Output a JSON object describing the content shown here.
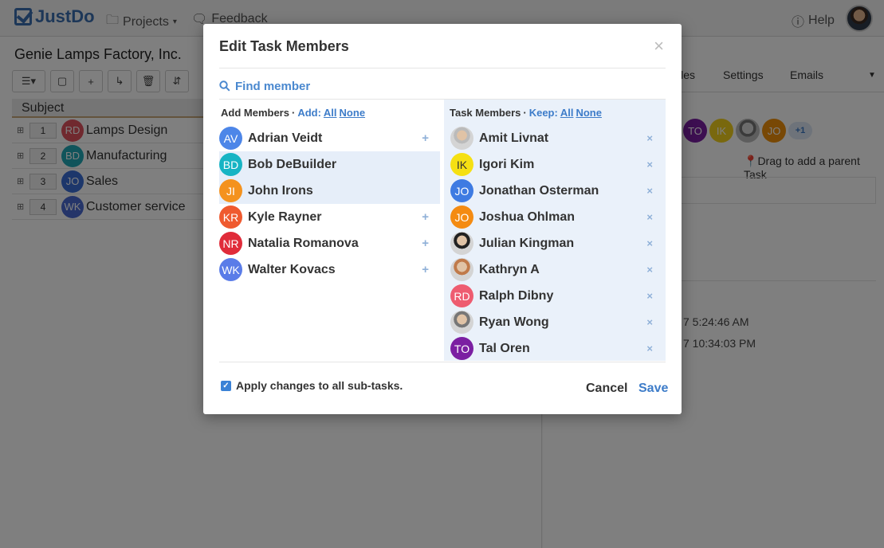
{
  "topbar": {
    "logo_text": "JustDo",
    "projects_label": "Projects",
    "feedback_label": "Feedback",
    "help_label": "Help"
  },
  "left": {
    "project_title": "Genie Lamps Factory, Inc.",
    "subject_header": "Subject",
    "rows": [
      {
        "num": "1",
        "initials": "RD",
        "color": "#e0525f",
        "title": "Lamps Design"
      },
      {
        "num": "2",
        "initials": "BD",
        "color": "#21a9b6",
        "title": "Manufacturing"
      },
      {
        "num": "3",
        "initials": "JO",
        "color": "#3a6fd6",
        "title": "Sales"
      },
      {
        "num": "4",
        "initials": "WK",
        "color": "#4b6bd3",
        "title": "Customer service"
      }
    ]
  },
  "right": {
    "tabs": [
      "iles",
      "Settings",
      "Emails"
    ],
    "members": [
      {
        "initials": "TO",
        "color": "#7b1fa2"
      },
      {
        "initials": "IK",
        "color": "#f3d11c"
      },
      {
        "initials": "",
        "color": "#8a8a8a"
      },
      {
        "initials": "JO",
        "color": "#f0900a"
      }
    ],
    "more_badge": "+1",
    "drag_text": "Drag to add a parent Task",
    "timestamps": [
      "7 5:24:46 AM",
      "7 10:34:03 PM"
    ]
  },
  "modal": {
    "title": "Edit Task Members",
    "close_label": "×",
    "search_placeholder": "Find member",
    "add_header": "Add Members",
    "add_label": "Add:",
    "task_header": "Task Members",
    "keep_label": "Keep:",
    "all_label": "All",
    "none_label": "None",
    "dot": "·",
    "add_members": [
      {
        "name": "Adrian Veidt",
        "initials": "AV",
        "color": "#4d86e8",
        "photo": false,
        "highlight": false,
        "action": "+"
      },
      {
        "name": "Bob DeBuilder",
        "initials": "BD",
        "color": "#17b4c4",
        "photo": false,
        "highlight": true,
        "action": ""
      },
      {
        "name": "John Irons",
        "initials": "JI",
        "color": "#f4921e",
        "photo": false,
        "highlight": true,
        "action": ""
      },
      {
        "name": "Kyle Rayner",
        "initials": "KR",
        "color": "#ef5a2f",
        "photo": false,
        "highlight": false,
        "action": "+"
      },
      {
        "name": "Natalia Romanova",
        "initials": "NR",
        "color": "#e02c3a",
        "photo": false,
        "highlight": false,
        "action": "+"
      },
      {
        "name": "Walter Kovacs",
        "initials": "WK",
        "color": "#5a7ce8",
        "photo": false,
        "highlight": false,
        "action": "+"
      }
    ],
    "task_members": [
      {
        "name": "Amit Livnat",
        "initials": "",
        "color": "#bbbbbb",
        "photo": true,
        "action": "×"
      },
      {
        "name": "Igori Kim",
        "initials": "IK",
        "color": "#f5e013",
        "photo": false,
        "action": "×"
      },
      {
        "name": "Jonathan Osterman",
        "initials": "JO",
        "color": "#3e7be2",
        "photo": false,
        "action": "×"
      },
      {
        "name": "Joshua Ohlman",
        "initials": "JO",
        "color": "#f48b12",
        "photo": false,
        "action": "×"
      },
      {
        "name": "Julian Kingman",
        "initials": "",
        "color": "#222222",
        "photo": true,
        "action": "×"
      },
      {
        "name": "Kathryn A",
        "initials": "",
        "color": "#c07a4a",
        "photo": true,
        "action": "×"
      },
      {
        "name": "Ralph Dibny",
        "initials": "RD",
        "color": "#ee5c70",
        "photo": false,
        "action": "×"
      },
      {
        "name": "Ryan Wong",
        "initials": "",
        "color": "#777777",
        "photo": true,
        "action": "×"
      },
      {
        "name": "Tal Oren",
        "initials": "TO",
        "color": "#7b1fa2",
        "photo": false,
        "action": "×"
      }
    ],
    "apply_label": "Apply changes to all sub-tasks.",
    "apply_checked": true,
    "cancel_label": "Cancel",
    "save_label": "Save"
  }
}
